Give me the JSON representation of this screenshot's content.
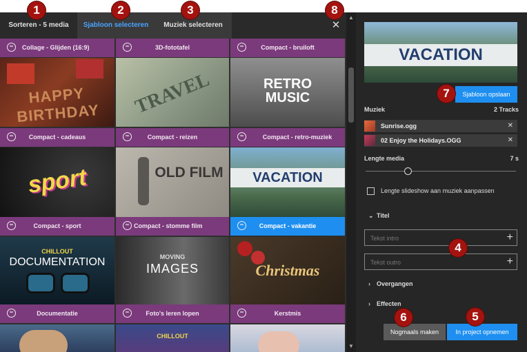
{
  "tabs": {
    "sort": "Sorteren - 5 media",
    "template": "Sjabloon selecteren",
    "music": "Muziek selecteren"
  },
  "close_glyph": "✕",
  "loop_glyph": "∞",
  "tiles": {
    "row0": [
      "Collage - Glijden (16:9)",
      "3D-fototafel",
      "Compact - bruiloft"
    ],
    "row1": [
      "Compact - cadeaus",
      "Compact - reizen",
      "Compact - retro-muziek"
    ],
    "row2": [
      "Compact - sport",
      "Compact - stomme film",
      "Compact - vakantie"
    ],
    "row3": [
      "Documentatie",
      "Foto's leren lopen",
      "Kerstmis"
    ]
  },
  "thumb_text": {
    "birthday": "HAPPY BIRTHDAY",
    "travel": "TRAVEL",
    "retro": "RETRO MUSIC",
    "sport": "sport",
    "oldfilm": "OLD FILM",
    "vacation": "VACATION",
    "chillout": "CHILLOUT",
    "documentation": "DOCUMENTATION",
    "moving": "MOVING",
    "images": "IMAGES",
    "christmas": "Christmas",
    "chillout2": "CHILLOUT"
  },
  "preview_text": "VACATION",
  "save_template": "Sjabloon opslaan",
  "music": {
    "label": "Muziek",
    "count": "2 Tracks",
    "tracks": [
      "Sunrise.ogg",
      "02 Enjoy the Holidays.OGG"
    ]
  },
  "length": {
    "label": "Lengte media",
    "value": "7 s"
  },
  "fit_checkbox": "Lengte slideshow aan muziek aanpassen",
  "title_section": "Titel",
  "intro_placeholder": "Tekst intro",
  "outro_placeholder": "Tekst outro",
  "transitions": "Overgangen",
  "effects": "Effecten",
  "redo_button": "Nogmaals maken",
  "add_button": "In project opnemen",
  "badges": [
    "1",
    "2",
    "3",
    "4",
    "5",
    "6",
    "7",
    "8"
  ],
  "colors": {
    "accent": "#1e8ff0",
    "tile_label": "#7b3a7b",
    "badge": "#a4130f"
  }
}
